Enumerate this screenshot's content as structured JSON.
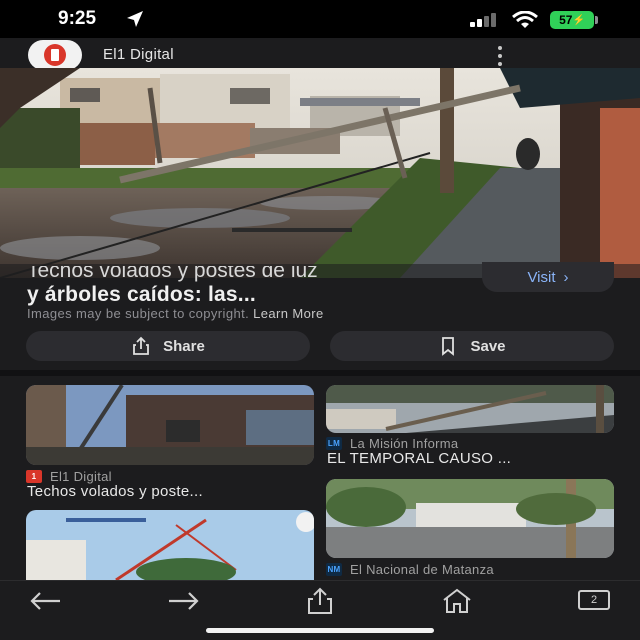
{
  "status_bar": {
    "time": "9:25",
    "battery": "57"
  },
  "header": {
    "site_name": "El1 Digital",
    "logo_icon": "el1-logo",
    "menu_icon": "more-vertical-icon"
  },
  "result": {
    "title_partial_line": "Techos volados y postes de luz",
    "title_line2": "y árboles caídos: las...",
    "visit_label": "Visit",
    "copyright_text": "Images may be subject to copyright.",
    "learn_more": "Learn More",
    "share_label": "Share",
    "save_label": "Save"
  },
  "related": [
    {
      "source": "El1 Digital",
      "source_badge": "1",
      "badge_color": "#d9362a",
      "title": "Techos volados y poste..."
    },
    {
      "source": "La Misión Informa",
      "source_badge": "LM",
      "badge_color": "#4aa3ff",
      "title": "EL TEMPORAL CAUSO ..."
    },
    {
      "source": "El Nacional de Matanza",
      "source_badge": "NM",
      "badge_color": "#4aa3ff",
      "title": ""
    }
  ],
  "toolbar": {
    "tab_count": "2"
  },
  "icons": {
    "back": "arrow-left-icon",
    "forward": "arrow-right-icon",
    "share": "share-icon",
    "home": "home-icon",
    "tabs": "tabs-icon",
    "location": "location-arrow-icon",
    "bookmark": "bookmark-icon",
    "signal": "signal-icon",
    "wifi": "wifi-icon"
  },
  "colors": {
    "background": "#1c1c1e",
    "button": "#2c2c30",
    "link": "#8ab4f8",
    "battery": "#30d158"
  }
}
